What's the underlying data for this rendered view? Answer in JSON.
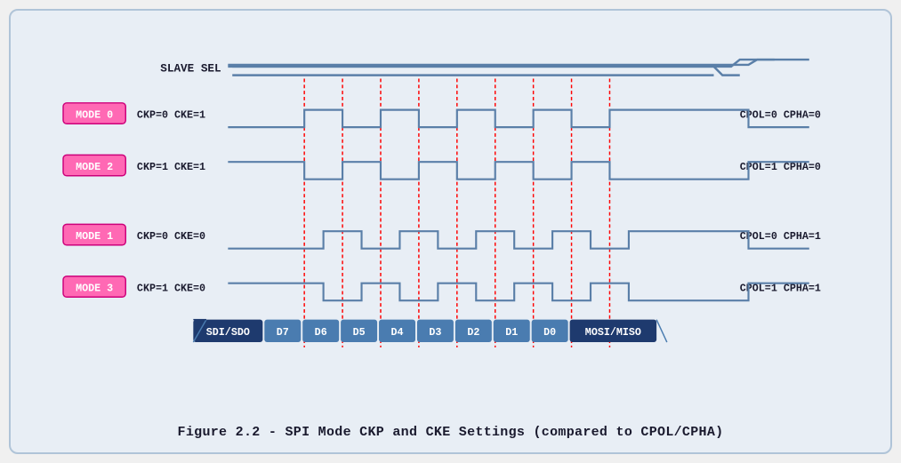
{
  "caption": "Figure 2.2 - SPI Mode CKP and CKE Settings (compared to CPOL/CPHA)",
  "diagram": {
    "slavesel_label": "SLAVE SEL",
    "modes": [
      {
        "label": "MODE 0",
        "params": "CKP=0  CKE=1",
        "right": "CPOL=0  CPHA=0"
      },
      {
        "label": "MODE 2",
        "params": "CKP=1  CKE=1",
        "right": "CPOL=1  CPHA=0"
      },
      {
        "label": "MODE 1",
        "params": "CKP=0  CKE=0",
        "right": "CPOL=0  CPHA=1"
      },
      {
        "label": "MODE 3",
        "params": "CKP=1  CKE=0",
        "right": "CPOL=1  CPHA=1"
      }
    ],
    "data_bits": [
      "SDI/SDO",
      "D7",
      "D6",
      "D5",
      "D4",
      "D3",
      "D2",
      "D1",
      "D0",
      "MOSI/MISO"
    ]
  }
}
